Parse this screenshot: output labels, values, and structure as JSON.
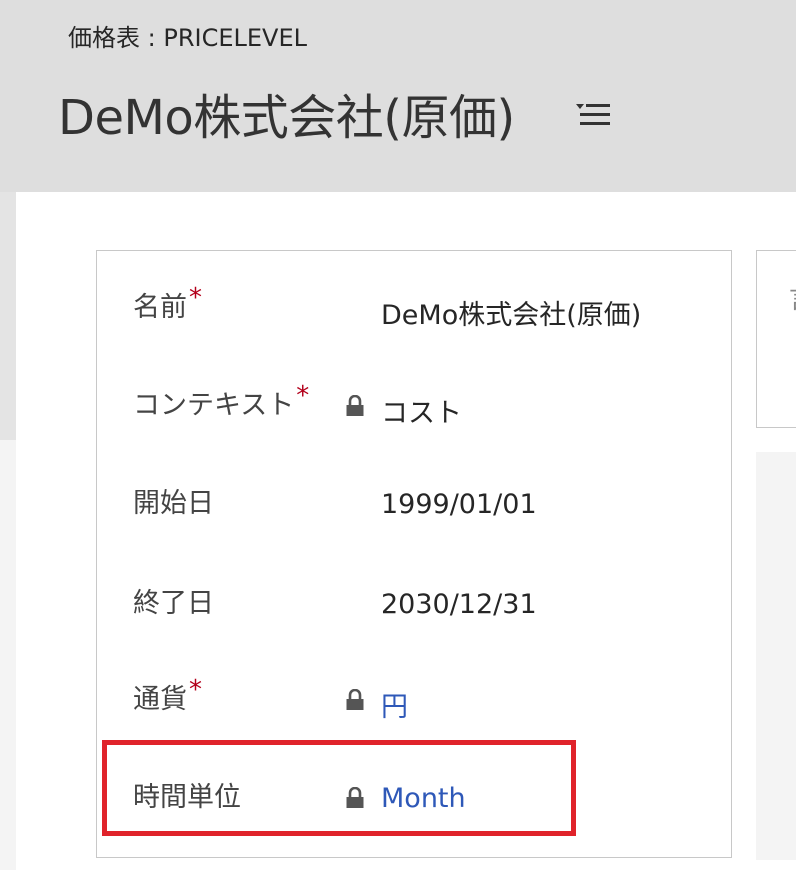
{
  "header": {
    "entity_label": "価格表 : PRICELEVEL",
    "record_title": "DeMo株式会社(原価)",
    "menu_icon": "list-menu-icon"
  },
  "form": {
    "fields": [
      {
        "label": "名前",
        "required": "*",
        "value": "DeMo株式会社(原価)",
        "locked": false,
        "link": false
      },
      {
        "label": "コンテキスト",
        "required": "*",
        "value": "コスト",
        "locked": true,
        "link": false
      },
      {
        "label": "開始日",
        "required": "",
        "value": "1999/01/01",
        "locked": false,
        "link": false
      },
      {
        "label": "終了日",
        "required": "",
        "value": "2030/12/31",
        "locked": false,
        "link": false
      },
      {
        "label": "通貨",
        "required": "*",
        "value": "円",
        "locked": true,
        "link": true
      },
      {
        "label": "時間単位",
        "required": "",
        "value": "Month",
        "locked": true,
        "link": true
      }
    ]
  },
  "side_card": {
    "partial_text": "言"
  },
  "colors": {
    "required": "#b3001b",
    "link": "#2e58b8",
    "highlight": "#e0232b"
  },
  "icons": {
    "lock": "lock-icon"
  }
}
